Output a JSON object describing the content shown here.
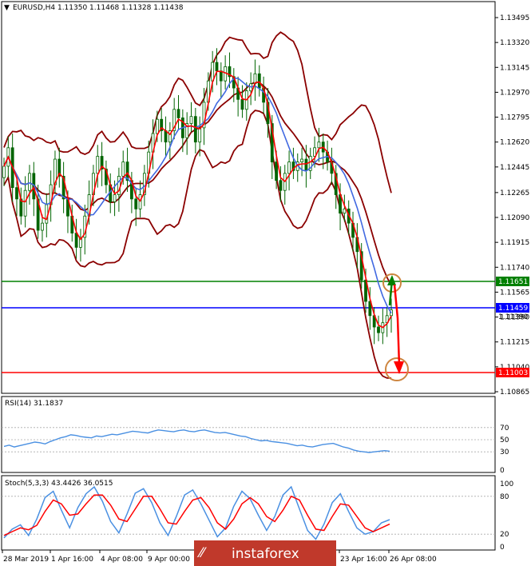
{
  "chart_data": [
    {
      "type": "candlestick",
      "title": "EURUSD,H4  1.11350 1.11468 1.11328 1.11438",
      "symbol": "EURUSD,H4",
      "ohlc_header": [
        "1.11350",
        "1.11468",
        "1.11328",
        "1.11438"
      ],
      "ylim": [
        1.10865,
        1.13495
      ],
      "y_ticks": [
        1.13495,
        1.1332,
        1.13145,
        1.1297,
        1.12795,
        1.1262,
        1.12445,
        1.12265,
        1.1209,
        1.11915,
        1.1174,
        1.11565,
        1.1139,
        1.11215,
        1.1104,
        1.10865
      ],
      "x_tick_labels": [
        "28 Mar 2019",
        "1 Apr 16:00",
        "4 Apr 08:00",
        "9 Apr 00:00",
        "23 Apr 16:00",
        "26 Apr 08:00"
      ],
      "close_series": [
        1.1245,
        1.1258,
        1.123,
        1.1222,
        1.121,
        1.1228,
        1.124,
        1.1222,
        1.12,
        1.1205,
        1.1218,
        1.1232,
        1.125,
        1.1238,
        1.1222,
        1.121,
        1.1198,
        1.1188,
        1.1195,
        1.121,
        1.1225,
        1.124,
        1.1252,
        1.1243,
        1.1232,
        1.122,
        1.1225,
        1.1238,
        1.1248,
        1.1235,
        1.1222,
        1.1215,
        1.1225,
        1.124,
        1.1255,
        1.1268,
        1.1278,
        1.127,
        1.1262,
        1.127,
        1.1285,
        1.1279,
        1.1265,
        1.1275,
        1.128,
        1.1262,
        1.1272,
        1.129,
        1.1305,
        1.1318,
        1.1312,
        1.1305,
        1.1315,
        1.1308,
        1.13,
        1.1292,
        1.1285,
        1.1298,
        1.1303,
        1.131,
        1.13,
        1.129,
        1.1275,
        1.1248,
        1.1235,
        1.1228,
        1.124,
        1.1248,
        1.1242,
        1.1248,
        1.125,
        1.1242,
        1.1252,
        1.1258,
        1.1262,
        1.1255,
        1.1248,
        1.124,
        1.1225,
        1.1212,
        1.1215,
        1.1205,
        1.1195,
        1.1185,
        1.1165,
        1.115,
        1.114,
        1.1132,
        1.1128,
        1.1135,
        1.114,
        1.1144
      ],
      "indicators": [
        "Bollinger Bands",
        "Moving Average (red)",
        "Moving Average (blue)"
      ],
      "levels": [
        {
          "value": "1.11651",
          "color": "#008000"
        },
        {
          "value": "1.11459",
          "color": "#0000ff"
        },
        {
          "value": "1.11003",
          "color": "#ff0000"
        }
      ],
      "annotation": "projected move up to 1.11651 then down to 1.11003"
    },
    {
      "type": "line",
      "title": "RSI(14) 31.1837",
      "ylim": [
        0,
        100
      ],
      "y_ticks": [
        70,
        50,
        30,
        0
      ],
      "values": [
        39,
        41,
        38,
        40,
        42,
        44,
        46,
        45,
        43,
        47,
        50,
        53,
        55,
        58,
        57,
        55,
        54,
        53,
        56,
        55,
        57,
        59,
        58,
        60,
        62,
        64,
        63,
        62,
        61,
        64,
        66,
        65,
        64,
        63,
        65,
        66,
        64,
        63,
        65,
        66,
        64,
        62,
        61,
        62,
        60,
        58,
        56,
        55,
        52,
        50,
        48,
        49,
        47,
        46,
        45,
        44,
        42,
        40,
        41,
        39,
        38,
        40,
        42,
        43,
        44,
        41,
        38,
        36,
        33,
        31,
        30,
        29,
        30,
        31,
        32,
        31
      ]
    },
    {
      "type": "line",
      "title": "Stoch(5,3,3) 43.4426 36.0515",
      "ylim": [
        0,
        100
      ],
      "y_ticks": [
        100,
        80,
        20,
        0
      ],
      "series": [
        {
          "values": [
            14,
            28,
            35,
            18,
            44,
            78,
            88,
            58,
            30,
            62,
            84,
            95,
            72,
            40,
            22,
            52,
            85,
            92,
            70,
            38,
            18,
            48,
            82,
            90,
            68,
            42,
            16,
            30,
            64,
            88,
            76,
            50,
            26,
            48,
            82,
            95,
            60,
            26,
            12,
            36,
            70,
            84,
            56,
            30,
            20,
            24,
            38,
            43
          ]
        },
        {
          "values": [
            18,
            24,
            30,
            27,
            34,
            56,
            74,
            68,
            50,
            52,
            68,
            82,
            82,
            66,
            44,
            40,
            60,
            80,
            80,
            60,
            38,
            36,
            56,
            74,
            78,
            62,
            38,
            28,
            44,
            68,
            78,
            68,
            48,
            40,
            58,
            80,
            74,
            50,
            28,
            26,
            48,
            68,
            66,
            48,
            30,
            24,
            30,
            36
          ]
        }
      ]
    }
  ],
  "price_labels": {
    "green": "1.11651",
    "blue": "1.11459",
    "red": "1.11003",
    "faint": "1.11390"
  },
  "rsi_ticks": [
    "70",
    "50",
    "30",
    "0"
  ],
  "stoch_ticks": [
    "100",
    "80",
    "20",
    "0"
  ],
  "colors": {
    "bollinger": "#8b0000",
    "ma_red": "#ff0000",
    "ma_blue": "#4169e1",
    "candle": "#006400",
    "rsi": "#4a90e2",
    "stoch_main": "#4a90e2",
    "stoch_signal": "#ff0000",
    "watermark_bg": "#c0392b"
  },
  "watermark": "instaforex"
}
